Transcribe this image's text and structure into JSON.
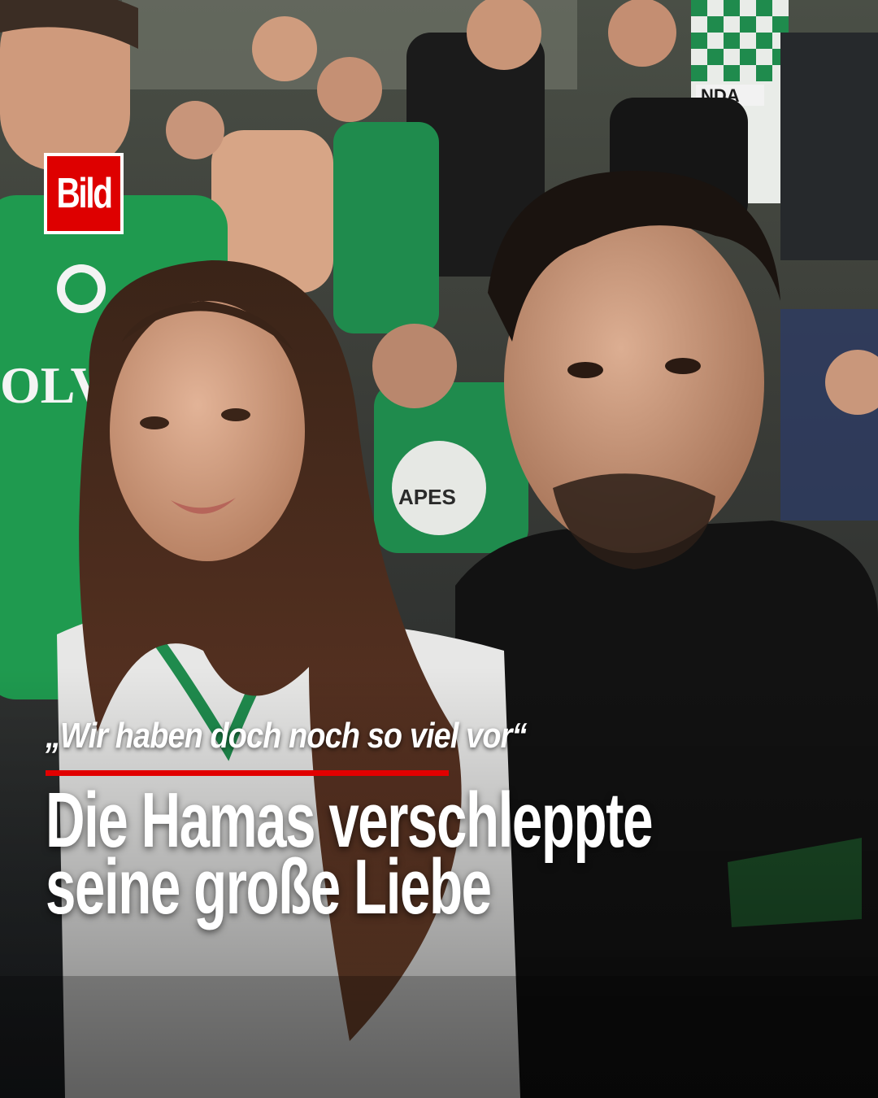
{
  "brand": {
    "logo_text": "Bild",
    "accent_color": "#de0000"
  },
  "headline": {
    "quote": "„Wir haben doch noch so viel vor“",
    "line1": "Die Hamas verschleppte",
    "line2": "seine große Liebe"
  },
  "photo": {
    "jersey_text_1": "OLVO",
    "jersey_text_2": "APES",
    "banner_text": "NDA"
  }
}
